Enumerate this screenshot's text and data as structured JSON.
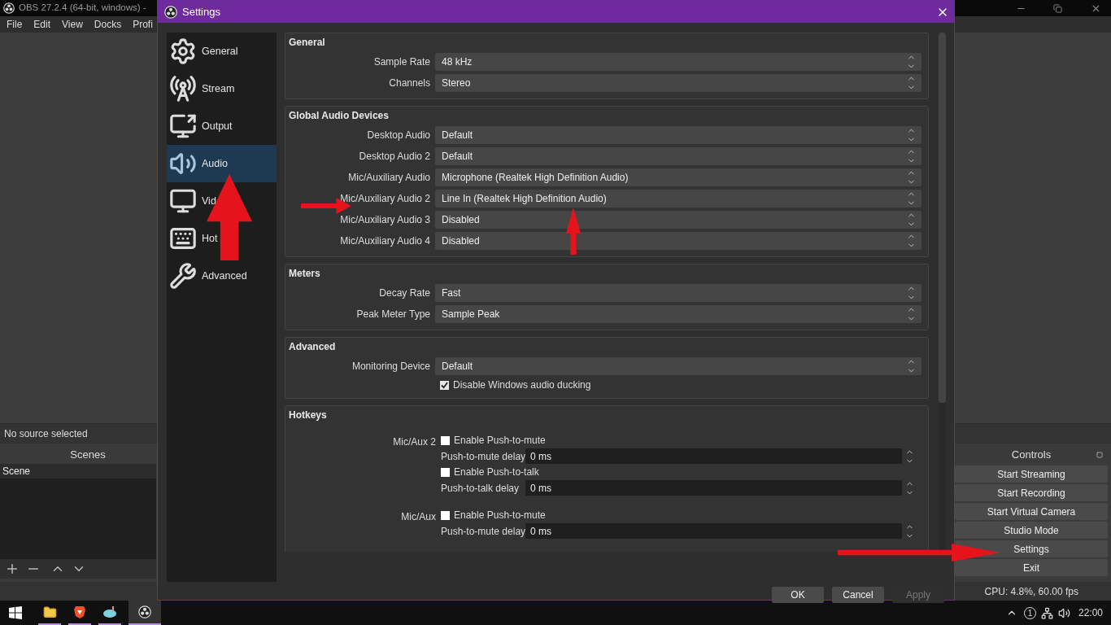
{
  "main_window": {
    "title": "OBS 27.2.4 (64-bit, windows) -",
    "menu": [
      "File",
      "Edit",
      "View",
      "Docks",
      "Profi"
    ],
    "source_bar": "No source selected",
    "scenes": {
      "title": "Scenes",
      "items": [
        {
          "label": "Scene",
          "selected": true
        }
      ]
    },
    "controls": {
      "title": "Controls",
      "buttons": [
        "Start Streaming",
        "Start Recording",
        "Start Virtual Camera",
        "Studio Mode",
        "Settings",
        "Exit"
      ]
    },
    "status": "CPU: 4.8%, 60.00 fps"
  },
  "taskbar": {
    "notification_count": "1",
    "time": "22:00"
  },
  "settings": {
    "title": "Settings",
    "nav": [
      {
        "label": "General",
        "selected": false
      },
      {
        "label": "Stream",
        "selected": false
      },
      {
        "label": "Output",
        "selected": false
      },
      {
        "label": "Audio",
        "selected": true
      },
      {
        "label": "Vid",
        "selected": false
      },
      {
        "label": "Hot",
        "selected": false
      },
      {
        "label": "Advanced",
        "selected": false
      }
    ],
    "sections": [
      {
        "title": "General",
        "rows": [
          {
            "kind": "select",
            "label": "Sample Rate",
            "value": "48 kHz"
          },
          {
            "kind": "select",
            "label": "Channels",
            "value": "Stereo"
          }
        ]
      },
      {
        "title": "Global Audio Devices",
        "rows": [
          {
            "kind": "select",
            "label": "Desktop Audio",
            "value": "Default"
          },
          {
            "kind": "select",
            "label": "Desktop Audio 2",
            "value": "Default"
          },
          {
            "kind": "select",
            "label": "Mic/Auxiliary Audio",
            "value": "Microphone (Realtek High Definition Audio)"
          },
          {
            "kind": "select",
            "label": "Mic/Auxiliary Audio 2",
            "value": "Line In (Realtek High Definition Audio)"
          },
          {
            "kind": "select",
            "label": "Mic/Auxiliary Audio 3",
            "value": "Disabled"
          },
          {
            "kind": "select",
            "label": "Mic/Auxiliary Audio 4",
            "value": "Disabled"
          }
        ]
      },
      {
        "title": "Meters",
        "rows": [
          {
            "kind": "select",
            "label": "Decay Rate",
            "value": "Fast"
          },
          {
            "kind": "select",
            "label": "Peak Meter Type",
            "value": "Sample Peak"
          }
        ]
      },
      {
        "title": "Advanced",
        "rows": [
          {
            "kind": "select",
            "label": "Monitoring Device",
            "value": "Default"
          },
          {
            "kind": "checkbox",
            "label": "Disable Windows audio ducking",
            "checked": true
          }
        ]
      }
    ],
    "hotkeys": {
      "title": "Hotkeys",
      "groups": [
        {
          "label": "Mic/Aux 2",
          "items": [
            {
              "kind": "checkbox",
              "label": "Enable Push-to-mute",
              "checked": false
            },
            {
              "kind": "spin",
              "label": "Push-to-mute delay",
              "value": "0 ms"
            },
            {
              "kind": "checkbox",
              "label": "Enable Push-to-talk",
              "checked": false
            },
            {
              "kind": "spin",
              "label": "Push-to-talk delay",
              "value": "0 ms"
            }
          ]
        },
        {
          "label": "Mic/Aux",
          "items": [
            {
              "kind": "checkbox",
              "label": "Enable Push-to-mute",
              "checked": false
            },
            {
              "kind": "spin",
              "label": "Push-to-mute delay",
              "value": "0 ms"
            }
          ]
        }
      ]
    },
    "buttons": [
      {
        "label": "OK",
        "disabled": false
      },
      {
        "label": "Cancel",
        "disabled": false
      },
      {
        "label": "Apply",
        "disabled": true
      }
    ]
  }
}
